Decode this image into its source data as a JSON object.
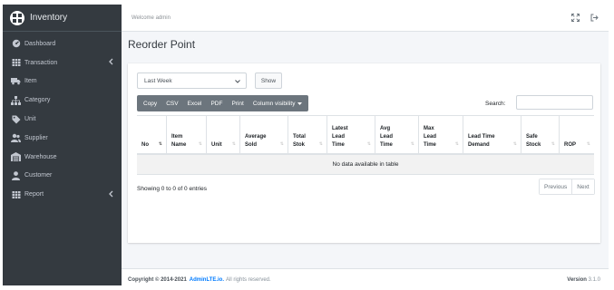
{
  "brand": {
    "name": "Inventory"
  },
  "sidebar": {
    "items": [
      {
        "label": "Dashboard",
        "icon": "dashboard-icon"
      },
      {
        "label": "Transaction",
        "icon": "table-icon",
        "has_children": true
      },
      {
        "label": "Item",
        "icon": "truck-icon"
      },
      {
        "label": "Category",
        "icon": "sitemap-icon"
      },
      {
        "label": "Unit",
        "icon": "tag-icon"
      },
      {
        "label": "Supplier",
        "icon": "users-icon"
      },
      {
        "label": "Warehouse",
        "icon": "warehouse-icon"
      },
      {
        "label": "Customer",
        "icon": "user-icon"
      },
      {
        "label": "Report",
        "icon": "table-icon",
        "has_children": true
      }
    ]
  },
  "header": {
    "welcome": "Welcome admin",
    "icons": [
      "expand-icon",
      "logout-icon"
    ]
  },
  "page": {
    "title": "Reorder Point"
  },
  "filter": {
    "selected": "Last Week",
    "show_label": "Show"
  },
  "export_buttons": [
    "Copy",
    "CSV",
    "Excel",
    "PDF",
    "Print",
    "Column visibility"
  ],
  "search": {
    "label": "Search:",
    "value": ""
  },
  "table": {
    "columns": [
      "No",
      "Item Name",
      "Unit",
      "Average Sold",
      "Total Stok",
      "Latest Lead Time",
      "Avg Lead Time",
      "Max Lead Time",
      "Lead Time Demand",
      "Safe Stock",
      "ROP"
    ],
    "rows": [],
    "empty_message": "No data available in table",
    "sorted_column": "No"
  },
  "pagination": {
    "info": "Showing 0 to 0 of 0 entries",
    "previous_label": "Previous",
    "next_label": "Next"
  },
  "footer": {
    "copyright_prefix": "Copyright © 2014-2021",
    "link_text": "AdminLTE.io.",
    "rights": "All rights reserved.",
    "version_label": "Version",
    "version_number": "3.1.0"
  },
  "colors": {
    "sidebar_bg": "#343a40",
    "content_bg": "#f4f6f9",
    "button_group_bg": "#6c757d",
    "link": "#007bff"
  }
}
